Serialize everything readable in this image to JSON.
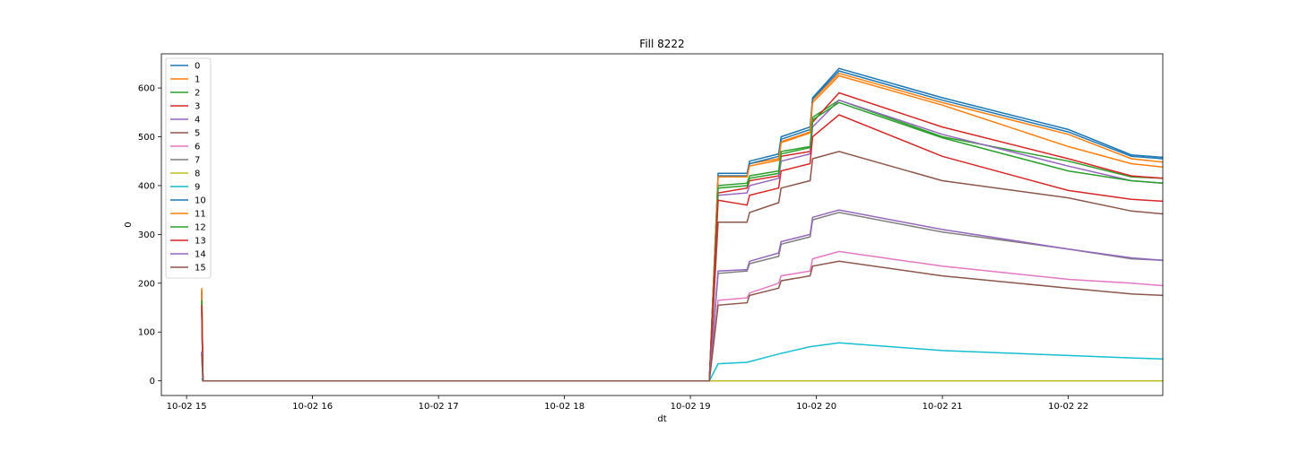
{
  "chart_data": {
    "type": "line",
    "title": "Fill 8222",
    "xlabel": "dt",
    "ylabel": "0",
    "x_ticks": [
      "10-02 15",
      "10-02 16",
      "10-02 17",
      "10-02 18",
      "10-02 19",
      "10-02 20",
      "10-02 21",
      "10-02 22"
    ],
    "x_unit": "hours after 10-02 15:00",
    "xlim": [
      -0.2,
      7.75
    ],
    "y_ticks": [
      0,
      100,
      200,
      300,
      400,
      500,
      600
    ],
    "ylim": [
      -30,
      670
    ],
    "grid": false,
    "legend_position": "top-left",
    "colors": [
      "#1f77b4",
      "#ff7f0e",
      "#2ca02c",
      "#d62728",
      "#9467bd",
      "#8c564b",
      "#e377c2",
      "#7f7f7f",
      "#bcbd22",
      "#17becf"
    ],
    "series": [
      {
        "name": "0",
        "values": [
          [
            0.12,
            180
          ],
          [
            0.13,
            0
          ],
          [
            4.15,
            0
          ],
          [
            4.22,
            425
          ],
          [
            4.45,
            425
          ],
          [
            4.47,
            450
          ],
          [
            4.7,
            465
          ],
          [
            4.72,
            500
          ],
          [
            4.95,
            520
          ],
          [
            4.97,
            580
          ],
          [
            5.18,
            640
          ],
          [
            6.0,
            580
          ],
          [
            7.0,
            515
          ],
          [
            7.5,
            463
          ],
          [
            7.75,
            458
          ]
        ]
      },
      {
        "name": "1",
        "values": [
          [
            0.12,
            190
          ],
          [
            0.13,
            0
          ],
          [
            4.15,
            0
          ],
          [
            4.22,
            420
          ],
          [
            4.45,
            420
          ],
          [
            4.47,
            445
          ],
          [
            4.7,
            455
          ],
          [
            4.72,
            490
          ],
          [
            4.95,
            510
          ],
          [
            4.97,
            575
          ],
          [
            5.18,
            630
          ],
          [
            6.0,
            570
          ],
          [
            7.0,
            505
          ],
          [
            7.5,
            455
          ],
          [
            7.75,
            448
          ]
        ]
      },
      {
        "name": "2",
        "values": [
          [
            0.12,
            170
          ],
          [
            0.13,
            0
          ],
          [
            4.15,
            0
          ],
          [
            4.22,
            400
          ],
          [
            4.45,
            405
          ],
          [
            4.47,
            420
          ],
          [
            4.7,
            430
          ],
          [
            4.72,
            470
          ],
          [
            4.95,
            480
          ],
          [
            4.97,
            540
          ],
          [
            5.18,
            575
          ],
          [
            6.0,
            500
          ],
          [
            7.0,
            450
          ],
          [
            7.5,
            418
          ],
          [
            7.75,
            415
          ]
        ]
      },
      {
        "name": "3",
        "values": [
          [
            0.12,
            160
          ],
          [
            0.13,
            0
          ],
          [
            4.15,
            0
          ],
          [
            4.22,
            385
          ],
          [
            4.45,
            395
          ],
          [
            4.47,
            410
          ],
          [
            4.7,
            420
          ],
          [
            4.72,
            460
          ],
          [
            4.95,
            470
          ],
          [
            4.97,
            530
          ],
          [
            5.18,
            590
          ],
          [
            6.0,
            520
          ],
          [
            7.0,
            455
          ],
          [
            7.5,
            420
          ],
          [
            7.75,
            415
          ]
        ]
      },
      {
        "name": "4",
        "values": [
          [
            0.12,
            150
          ],
          [
            0.13,
            0
          ],
          [
            4.15,
            0
          ],
          [
            4.22,
            380
          ],
          [
            4.45,
            385
          ],
          [
            4.47,
            400
          ],
          [
            4.7,
            415
          ],
          [
            4.72,
            450
          ],
          [
            4.95,
            465
          ],
          [
            4.97,
            520
          ],
          [
            5.18,
            575
          ],
          [
            6.0,
            505
          ],
          [
            7.0,
            440
          ],
          [
            7.5,
            410
          ],
          [
            7.75,
            405
          ]
        ]
      },
      {
        "name": "5",
        "values": [
          [
            0.12,
            140
          ],
          [
            0.13,
            0
          ],
          [
            4.15,
            0
          ],
          [
            4.22,
            325
          ],
          [
            4.45,
            325
          ],
          [
            4.47,
            345
          ],
          [
            4.7,
            365
          ],
          [
            4.72,
            395
          ],
          [
            4.95,
            410
          ],
          [
            4.97,
            455
          ],
          [
            5.18,
            470
          ],
          [
            6.0,
            410
          ],
          [
            7.0,
            375
          ],
          [
            7.5,
            348
          ],
          [
            7.75,
            342
          ]
        ]
      },
      {
        "name": "6",
        "values": [
          [
            0.12,
            60
          ],
          [
            0.13,
            0
          ],
          [
            4.15,
            0
          ],
          [
            4.22,
            165
          ],
          [
            4.45,
            170
          ],
          [
            4.47,
            180
          ],
          [
            4.7,
            200
          ],
          [
            4.72,
            215
          ],
          [
            4.95,
            225
          ],
          [
            4.97,
            250
          ],
          [
            5.18,
            265
          ],
          [
            6.0,
            235
          ],
          [
            7.0,
            208
          ],
          [
            7.5,
            200
          ],
          [
            7.75,
            195
          ]
        ]
      },
      {
        "name": "7",
        "values": [
          [
            0.12,
            60
          ],
          [
            0.13,
            0
          ],
          [
            4.15,
            0
          ],
          [
            4.22,
            220
          ],
          [
            4.45,
            225
          ],
          [
            4.47,
            240
          ],
          [
            4.7,
            255
          ],
          [
            4.72,
            280
          ],
          [
            4.95,
            295
          ],
          [
            4.97,
            330
          ],
          [
            5.18,
            345
          ],
          [
            6.0,
            305
          ],
          [
            7.0,
            270
          ],
          [
            7.5,
            250
          ],
          [
            7.75,
            247
          ]
        ]
      },
      {
        "name": "8",
        "values": [
          [
            0.12,
            0
          ],
          [
            0.13,
            0
          ],
          [
            4.15,
            0
          ],
          [
            4.22,
            0
          ],
          [
            5.0,
            0
          ],
          [
            6.0,
            0
          ],
          [
            7.0,
            0
          ],
          [
            7.75,
            0
          ]
        ]
      },
      {
        "name": "9",
        "values": [
          [
            0.12,
            5
          ],
          [
            0.13,
            0
          ],
          [
            4.15,
            0
          ],
          [
            4.22,
            35
          ],
          [
            4.45,
            38
          ],
          [
            4.7,
            55
          ],
          [
            4.95,
            70
          ],
          [
            5.18,
            78
          ],
          [
            6.0,
            62
          ],
          [
            7.0,
            52
          ],
          [
            7.5,
            47
          ],
          [
            7.75,
            45
          ]
        ]
      },
      {
        "name": "10",
        "values": [
          [
            0.12,
            185
          ],
          [
            0.13,
            0
          ],
          [
            4.15,
            0
          ],
          [
            4.22,
            420
          ],
          [
            4.45,
            420
          ],
          [
            4.47,
            445
          ],
          [
            4.7,
            460
          ],
          [
            4.72,
            495
          ],
          [
            4.95,
            515
          ],
          [
            4.97,
            578
          ],
          [
            5.18,
            635
          ],
          [
            6.0,
            575
          ],
          [
            7.0,
            510
          ],
          [
            7.5,
            460
          ],
          [
            7.75,
            455
          ]
        ]
      },
      {
        "name": "11",
        "values": [
          [
            0.12,
            188
          ],
          [
            0.13,
            0
          ],
          [
            4.15,
            0
          ],
          [
            4.22,
            418
          ],
          [
            4.45,
            418
          ],
          [
            4.47,
            440
          ],
          [
            4.7,
            452
          ],
          [
            4.72,
            488
          ],
          [
            4.95,
            508
          ],
          [
            4.97,
            570
          ],
          [
            5.18,
            625
          ],
          [
            6.0,
            565
          ],
          [
            7.0,
            480
          ],
          [
            7.5,
            445
          ],
          [
            7.75,
            438
          ]
        ]
      },
      {
        "name": "12",
        "values": [
          [
            0.12,
            165
          ],
          [
            0.13,
            0
          ],
          [
            4.15,
            0
          ],
          [
            4.22,
            395
          ],
          [
            4.45,
            400
          ],
          [
            4.47,
            415
          ],
          [
            4.7,
            425
          ],
          [
            4.72,
            465
          ],
          [
            4.95,
            478
          ],
          [
            4.97,
            535
          ],
          [
            5.18,
            570
          ],
          [
            6.0,
            498
          ],
          [
            7.0,
            430
          ],
          [
            7.5,
            410
          ],
          [
            7.75,
            405
          ]
        ]
      },
      {
        "name": "13",
        "values": [
          [
            0.12,
            155
          ],
          [
            0.13,
            0
          ],
          [
            4.15,
            0
          ],
          [
            4.22,
            370
          ],
          [
            4.45,
            360
          ],
          [
            4.47,
            380
          ],
          [
            4.7,
            395
          ],
          [
            4.72,
            430
          ],
          [
            4.95,
            445
          ],
          [
            4.97,
            500
          ],
          [
            5.18,
            545
          ],
          [
            6.0,
            460
          ],
          [
            7.0,
            390
          ],
          [
            7.5,
            372
          ],
          [
            7.75,
            368
          ]
        ]
      },
      {
        "name": "14",
        "values": [
          [
            0.12,
            60
          ],
          [
            0.13,
            0
          ],
          [
            4.15,
            0
          ],
          [
            4.22,
            225
          ],
          [
            4.45,
            228
          ],
          [
            4.47,
            245
          ],
          [
            4.7,
            262
          ],
          [
            4.72,
            285
          ],
          [
            4.95,
            300
          ],
          [
            4.97,
            335
          ],
          [
            5.18,
            350
          ],
          [
            6.0,
            310
          ],
          [
            7.0,
            270
          ],
          [
            7.5,
            252
          ],
          [
            7.75,
            247
          ]
        ]
      },
      {
        "name": "15",
        "values": [
          [
            0.12,
            55
          ],
          [
            0.13,
            0
          ],
          [
            4.15,
            0
          ],
          [
            4.22,
            155
          ],
          [
            4.45,
            160
          ],
          [
            4.47,
            175
          ],
          [
            4.7,
            190
          ],
          [
            4.72,
            205
          ],
          [
            4.95,
            215
          ],
          [
            4.97,
            235
          ],
          [
            5.18,
            245
          ],
          [
            6.0,
            215
          ],
          [
            7.0,
            190
          ],
          [
            7.5,
            178
          ],
          [
            7.75,
            175
          ]
        ]
      }
    ]
  }
}
